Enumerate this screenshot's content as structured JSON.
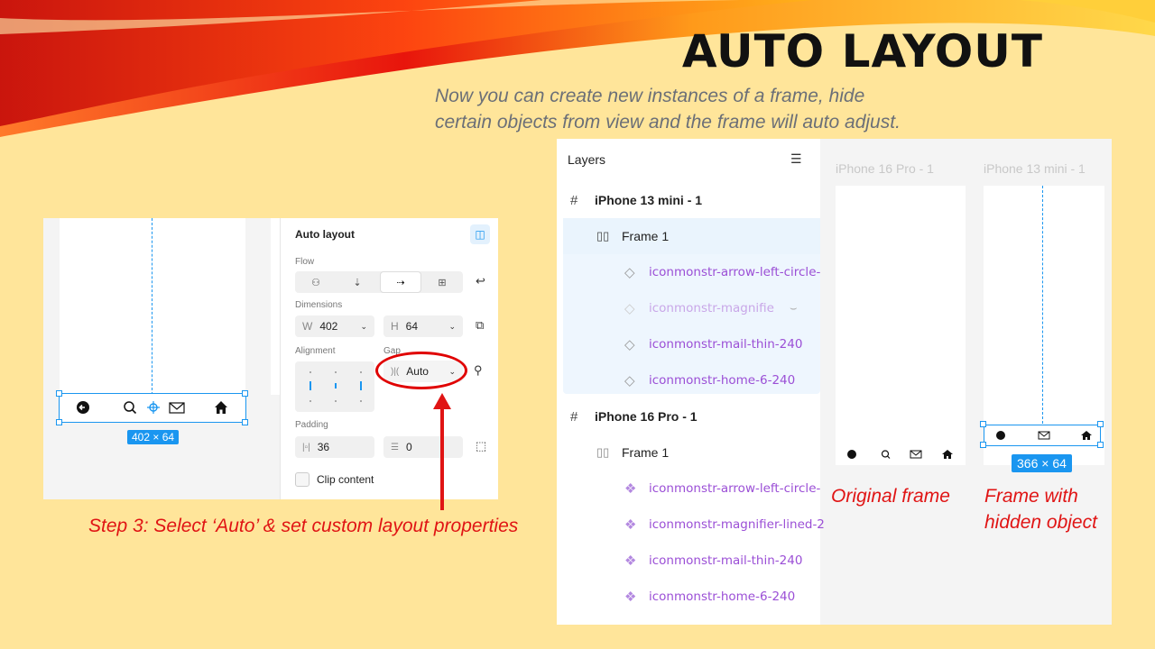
{
  "slide": {
    "title": "AUTO LAYOUT",
    "subtitle_line1": "Now you can create new instances of a frame, hide",
    "subtitle_line2": "certain objects from view and the frame will auto adjust.",
    "step_text": "Step 3: Select ‘Auto’ & set custom layout properties",
    "caption_original": "Original frame",
    "caption_hidden_line1": "Frame with",
    "caption_hidden_line2": "hidden object",
    "accent_color": "#e01414"
  },
  "left_screenshot": {
    "selection_size": "402 × 64",
    "panel": {
      "heading": "Auto layout",
      "flow_label": "Flow",
      "dimensions_label": "Dimensions",
      "width_key": "W",
      "width_value": "402",
      "height_key": "H",
      "height_value": "64",
      "alignment_label": "Alignment",
      "gap_label": "Gap",
      "gap_value": "Auto",
      "padding_label": "Padding",
      "padding_value": "36",
      "padding_vertical_value": "0",
      "clip_content_label": "Clip content",
      "clip_content_checked": false
    }
  },
  "right_screenshot": {
    "layers_title": "Layers",
    "layers": [
      {
        "type": "frame",
        "label": "iPhone 13 mini - 1"
      },
      {
        "type": "autolayout",
        "label": "Frame 1",
        "selected": true
      },
      {
        "type": "instance",
        "label": "iconmonstr-arrow-left-circle-"
      },
      {
        "type": "instance",
        "label": "iconmonstr-magnifie",
        "hidden": true
      },
      {
        "type": "instance",
        "label": "iconmonstr-mail-thin-240"
      },
      {
        "type": "instance",
        "label": "iconmonstr-home-6-240"
      },
      {
        "type": "frame",
        "label": "iPhone 16 Pro - 1"
      },
      {
        "type": "autolayout",
        "label": "Frame 1"
      },
      {
        "type": "component",
        "label": "iconmonstr-arrow-left-circle-"
      },
      {
        "type": "component",
        "label": "iconmonstr-magnifier-lined-2"
      },
      {
        "type": "component",
        "label": "iconmonstr-mail-thin-240"
      },
      {
        "type": "component",
        "label": "iconmonstr-home-6-240"
      }
    ],
    "canvas": {
      "frame_a_label": "iPhone 16 Pro - 1",
      "frame_b_label": "iPhone 13 mini - 1",
      "selection_size": "366 × 64"
    }
  }
}
